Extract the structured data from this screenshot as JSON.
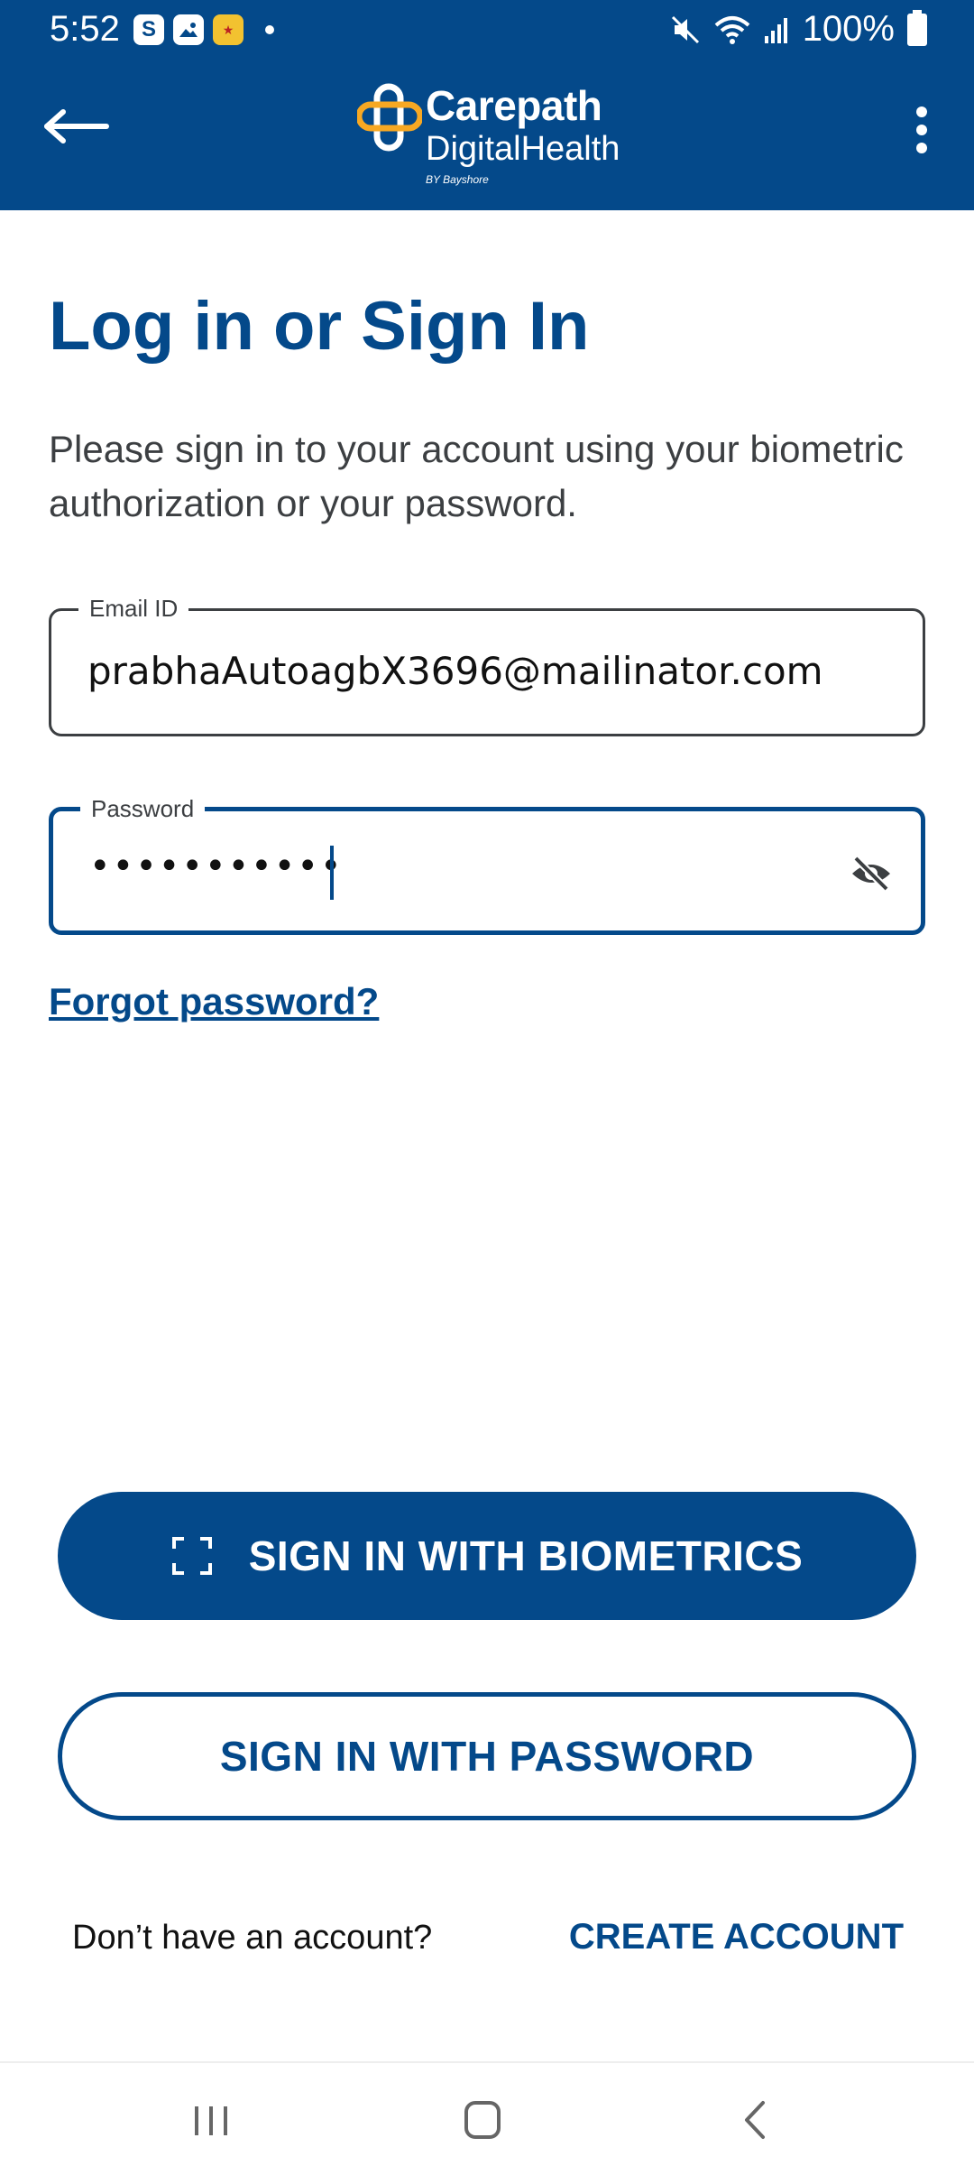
{
  "status_bar": {
    "time": "5:52",
    "battery": "100%"
  },
  "app_bar": {
    "logo_title": "Carepath",
    "logo_subtitle": "DigitalHealth",
    "logo_by": "BY Bayshore"
  },
  "login": {
    "title": "Log in or Sign In",
    "description": "Please sign in to your account using your biometric authorization or your password.",
    "email_label": "Email ID",
    "email_value": "prabhaAutoagbX3696@mailinator.com",
    "password_label": "Password",
    "password_value": "•••••••••••",
    "forgot_label": "Forgot password?"
  },
  "actions": {
    "biometrics_label": "SIGN IN WITH BIOMETRICS",
    "password_label": "SIGN IN WITH PASSWORD"
  },
  "footer": {
    "question": "Don’t have an account?",
    "create_label": "CREATE ACCOUNT"
  },
  "colors": {
    "brand_blue": "#04498a",
    "logo_orange": "#f7a823"
  }
}
